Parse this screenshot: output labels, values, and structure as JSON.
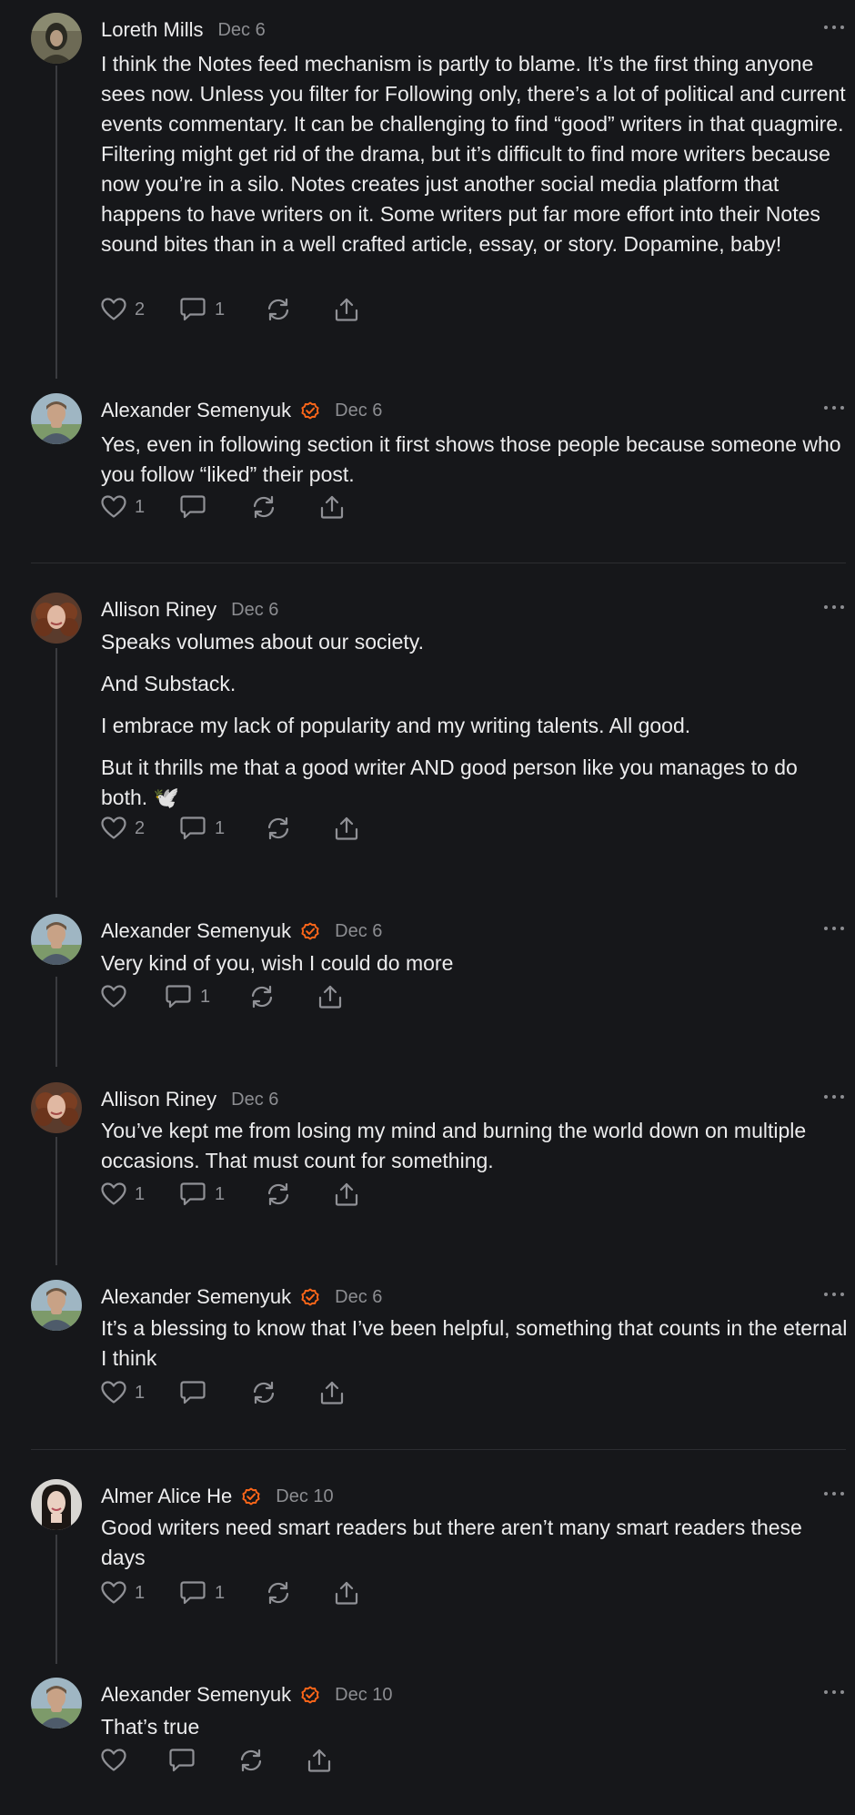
{
  "comments": [
    {
      "author": "Loreth Mills",
      "date": "Dec 6",
      "verified": false,
      "body": [
        "I think the Notes feed mechanism is partly to blame. It’s the first thing anyone sees now. Unless you filter for Following only, there’s a lot of political and current events commentary. It can be challenging to find “good” writers in that quagmire. Filtering might get rid of the drama, but it’s difficult to find more writers because now you’re in a silo. Notes creates just another social media platform that happens to have writers on it. Some writers put far more effort into their Notes sound bites than in a well crafted article, essay, or story. Dopamine, baby!"
      ],
      "likes": "2",
      "replies": "1"
    },
    {
      "author": "Alexander Semenyuk",
      "date": "Dec 6",
      "verified": true,
      "body": [
        "Yes, even in following section it first shows those people because someone who you follow “liked” their post."
      ],
      "likes": "1",
      "replies": ""
    },
    {
      "author": "Allison Riney",
      "date": "Dec 6",
      "verified": false,
      "body": [
        "Speaks volumes about our society.",
        "And Substack.",
        "I embrace my lack of popularity and my writing talents. All good.",
        "But it thrills me that a good writer AND good person like you manages to do both. 🕊️"
      ],
      "likes": "2",
      "replies": "1"
    },
    {
      "author": "Alexander Semenyuk",
      "date": "Dec 6",
      "verified": true,
      "body": [
        "Very kind of you, wish I could do more"
      ],
      "likes": "",
      "replies": "1"
    },
    {
      "author": "Allison Riney",
      "date": "Dec 6",
      "verified": false,
      "body": [
        "You’ve kept me from losing my mind and burning the world down on multiple occasions. That must count for something."
      ],
      "likes": "1",
      "replies": "1"
    },
    {
      "author": "Alexander Semenyuk",
      "date": "Dec 6",
      "verified": true,
      "body": [
        "It’s a blessing to know that I’ve been helpful, something that counts in the eternal I think"
      ],
      "likes": "1",
      "replies": ""
    },
    {
      "author": "Almer Alice He",
      "date": "Dec 10",
      "verified": true,
      "body": [
        "Good writers need smart readers but there aren’t many smart readers these days"
      ],
      "likes": "1",
      "replies": "1"
    },
    {
      "author": "Alexander Semenyuk",
      "date": "Dec 10",
      "verified": true,
      "body": [
        "That’s true"
      ],
      "likes": "",
      "replies": ""
    }
  ],
  "icons": {
    "like": "heart-icon",
    "reply": "speech-bubble-icon",
    "restack": "restack-icon",
    "share": "share-icon",
    "verified": "verified-check-icon",
    "more": "ellipsis-icon"
  },
  "colors": {
    "background": "#16171a",
    "text": "#ececed",
    "muted": "#8c8d91",
    "verified": "#ff6719",
    "thread_line": "#3a3b3f"
  }
}
